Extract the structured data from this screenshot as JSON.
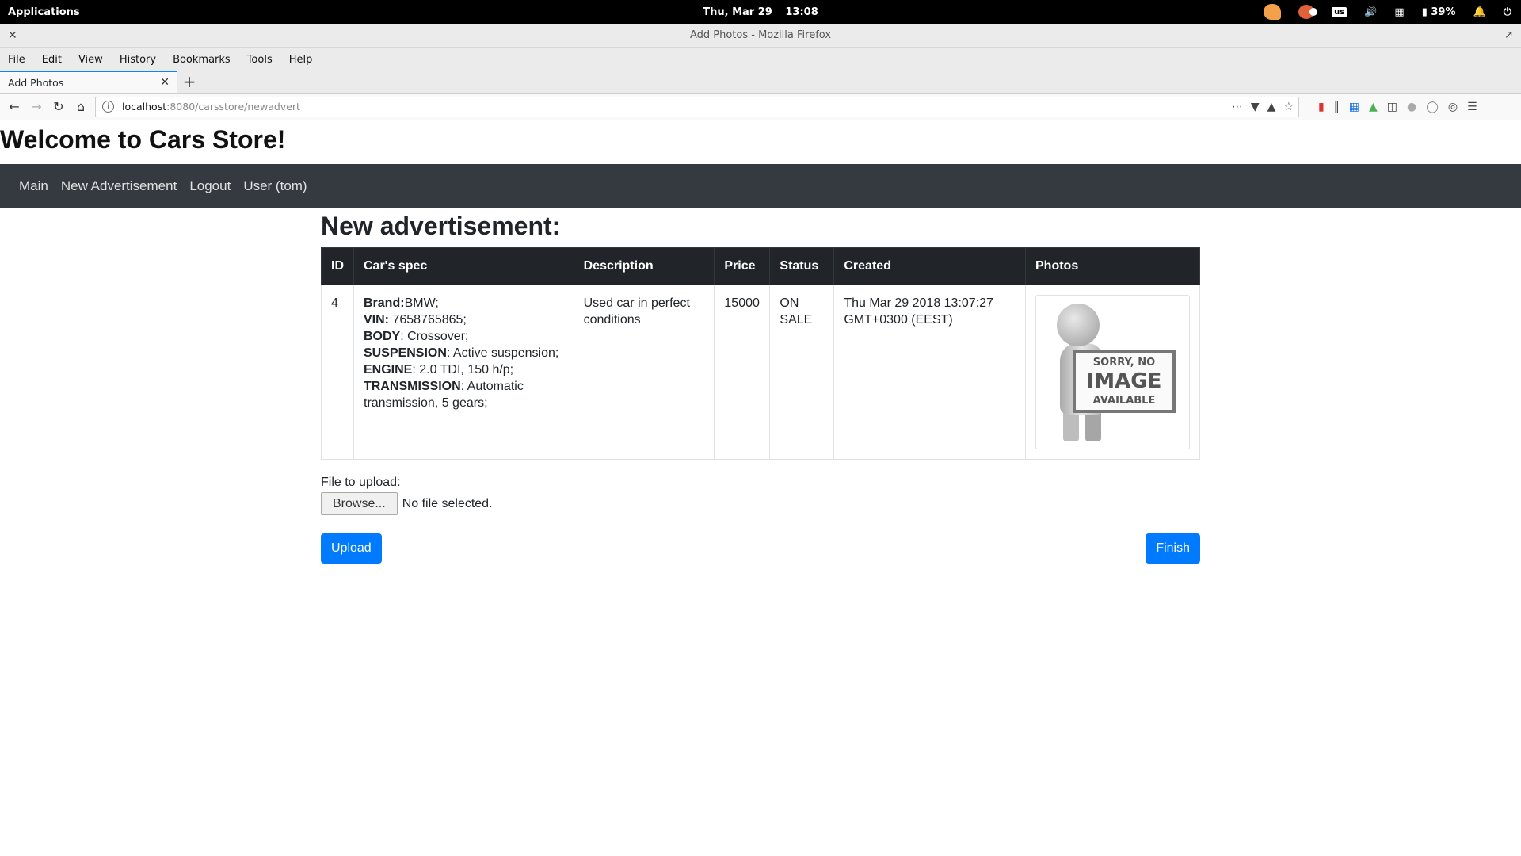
{
  "system_bar": {
    "applications": "Applications",
    "day": "Thu, Mar 29",
    "time": "13:08",
    "keyboard": "us",
    "battery": "39%"
  },
  "window": {
    "title": "Add Photos - Mozilla Firefox"
  },
  "menu": {
    "file": "File",
    "edit": "Edit",
    "view": "View",
    "history": "History",
    "bookmarks": "Bookmarks",
    "tools": "Tools",
    "help": "Help"
  },
  "tab": {
    "title": "Add Photos"
  },
  "url": {
    "host": "localhost",
    "path": ":8080/carsstore/newadvert"
  },
  "site": {
    "title": "Welcome to Cars Store!",
    "nav": {
      "main": "Main",
      "new_ad": "New Advertisement",
      "logout": "Logout",
      "user": "User (tom)"
    }
  },
  "advert": {
    "heading": "New advertisement:",
    "columns": {
      "id": "ID",
      "spec": "Car's spec",
      "description": "Description",
      "price": "Price",
      "status": "Status",
      "created": "Created",
      "photos": "Photos"
    },
    "row": {
      "id": "4",
      "brand_label": "Brand:",
      "brand": "BMW;",
      "vin_label": "VIN:",
      "vin": " 7658765865;",
      "body_label": "BODY",
      "body": ": Crossover;",
      "suspension_label": "SUSPENSION",
      "suspension": ": Active suspension;",
      "engine_label": "ENGINE",
      "engine": ": 2.0 TDI, 150 h/p;",
      "transmission_label": "TRANSMISSION",
      "transmission": ": Automatic transmission, 5 gears;",
      "description": "Used car in perfect conditions",
      "price": "15000",
      "status": "ON SALE",
      "created": "Thu Mar 29 2018 13:07:27 GMT+0300 (EEST)",
      "photo": {
        "line1": "SORRY, NO",
        "line2": "IMAGE",
        "line3": "AVAILABLE"
      }
    }
  },
  "upload": {
    "label": "File to upload:",
    "browse": "Browse...",
    "no_file": "No file selected.",
    "upload_button": "Upload",
    "finish_button": "Finish"
  }
}
